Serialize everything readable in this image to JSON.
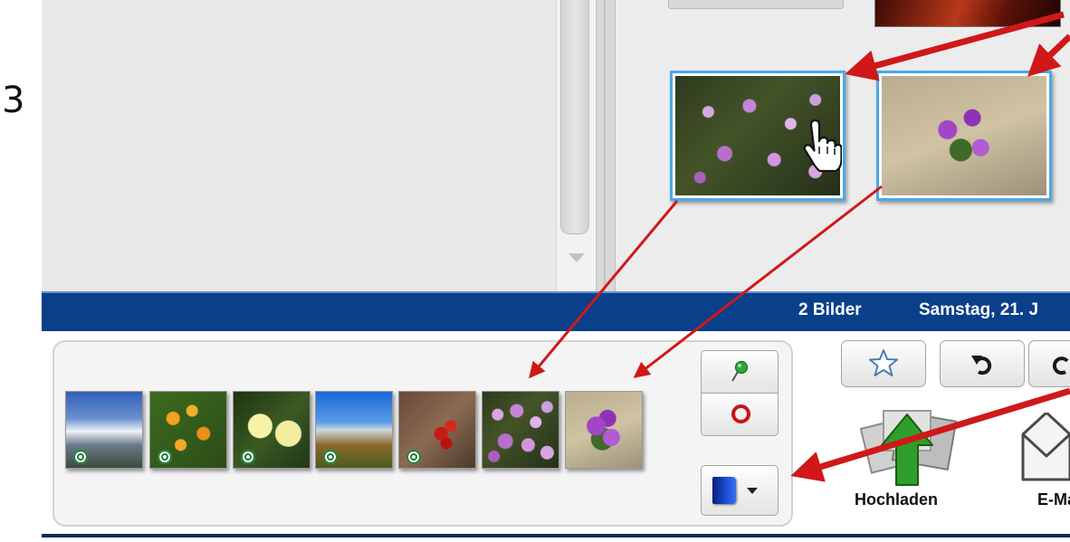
{
  "step": {
    "number": "3"
  },
  "status_bar": {
    "count": "2 Bilder",
    "date": "Samstag, 21. J"
  },
  "photos": [
    {
      "name": "selected-photo-pink-flowers"
    },
    {
      "name": "selected-photo-purple-flowers"
    }
  ],
  "tray": {
    "thumbnails": [
      {
        "subject": "mountain-glacier",
        "badge": true
      },
      {
        "subject": "orange-flowers",
        "badge": true
      },
      {
        "subject": "yellow-flowers",
        "badge": true
      },
      {
        "subject": "alpine-valley",
        "badge": true
      },
      {
        "subject": "red-berries",
        "badge": true
      },
      {
        "subject": "pink-flowers",
        "badge": false
      },
      {
        "subject": "purple-flowers",
        "badge": false
      }
    ],
    "buttons": {
      "pin_icon": "green-pushpin-icon",
      "ring_icon": "red-ring-icon",
      "album_icon": "blue-album-icon"
    }
  },
  "toolbar": {
    "upload_label": "Hochladen",
    "email_label": "E-Ma",
    "icons": [
      "star-icon",
      "rotate-left-icon",
      "rotate-right-icon",
      "upload-icon",
      "email-icon"
    ]
  },
  "colors": {
    "status_bar": "#0a3f8a",
    "selection_border": "#4aa8ea",
    "annotation_arrow": "#d01818"
  }
}
